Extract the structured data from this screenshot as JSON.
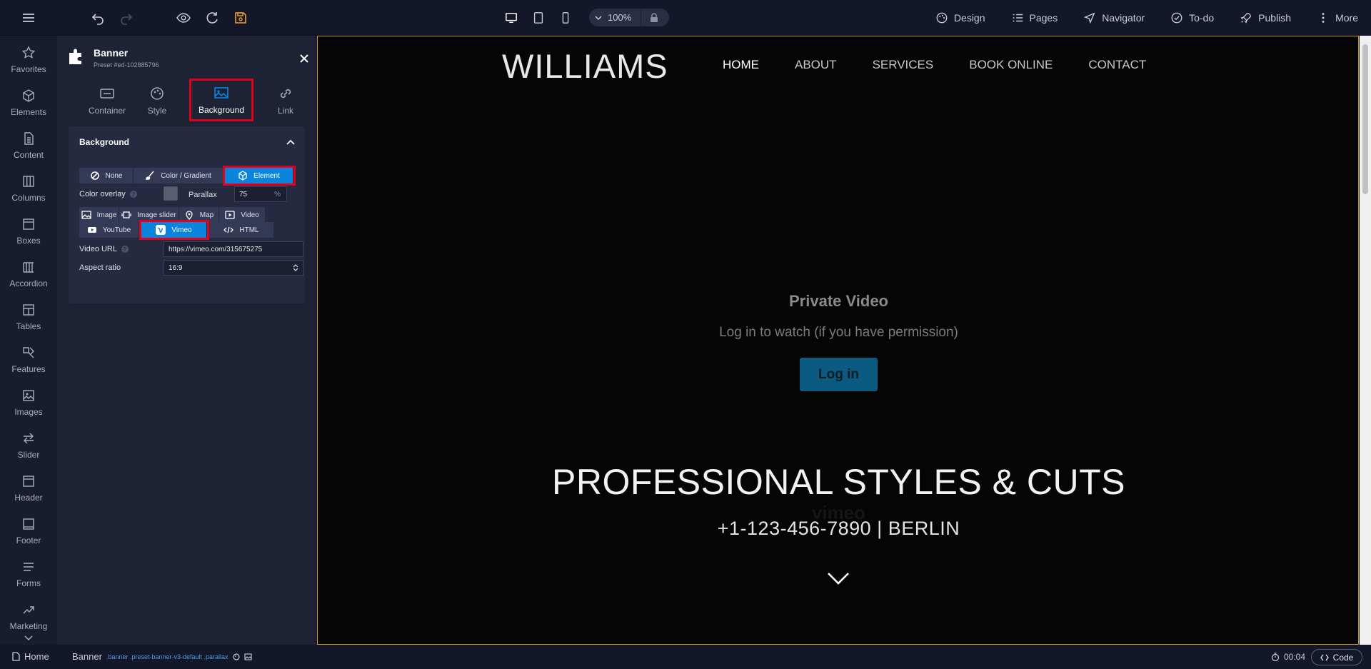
{
  "toolbar": {
    "zoom": "100%",
    "nav": [
      {
        "label": "Design",
        "icon": "palette-icon"
      },
      {
        "label": "Pages",
        "icon": "list-icon"
      },
      {
        "label": "Navigator",
        "icon": "navigation-arrow-icon"
      },
      {
        "label": "To-do",
        "icon": "check-circle-icon"
      },
      {
        "label": "Publish",
        "icon": "rocket-icon"
      },
      {
        "label": "More",
        "icon": "more-vertical-icon"
      }
    ]
  },
  "sidebar": {
    "items": [
      {
        "label": "Favorites",
        "icon": "star-icon"
      },
      {
        "label": "Elements",
        "icon": "cube-icon"
      },
      {
        "label": "Content",
        "icon": "document-icon"
      },
      {
        "label": "Columns",
        "icon": "columns-icon"
      },
      {
        "label": "Boxes",
        "icon": "box-icon"
      },
      {
        "label": "Accordion",
        "icon": "accordion-icon"
      },
      {
        "label": "Tables",
        "icon": "table-icon"
      },
      {
        "label": "Features",
        "icon": "features-icon"
      },
      {
        "label": "Images",
        "icon": "image-icon"
      },
      {
        "label": "Slider",
        "icon": "slider-arrows-icon"
      },
      {
        "label": "Header",
        "icon": "header-icon"
      },
      {
        "label": "Footer",
        "icon": "footer-icon"
      },
      {
        "label": "Forms",
        "icon": "form-icon"
      },
      {
        "label": "Marketing",
        "icon": "trend-icon"
      }
    ]
  },
  "panel": {
    "title": "Banner",
    "subtitle": "Preset #ed-102885796",
    "tabs": [
      "Container",
      "Style",
      "Background",
      "Link"
    ],
    "section_title": "Background",
    "bg_types": [
      "None",
      "Color / Gradient",
      "Element"
    ],
    "color_overlay_label": "Color overlay",
    "parallax_label": "Parallax",
    "parallax_value": "75",
    "parallax_unit": "%",
    "element_types_row1": [
      "Image",
      "Image slider",
      "Map",
      "Video"
    ],
    "element_types_row2": [
      "YouTube",
      "Vimeo",
      "HTML"
    ],
    "video_url_label": "Video URL",
    "video_url": "https://vimeo.com/315675275",
    "aspect_label": "Aspect ratio",
    "aspect_value": "16:9"
  },
  "site": {
    "logo": "WILLIAMS",
    "nav": [
      "HOME",
      "ABOUT",
      "SERVICES",
      "BOOK ONLINE",
      "CONTACT"
    ],
    "video_title": "Private Video",
    "video_sub": "Log in to watch (if you have permission)",
    "video_button": "Log in",
    "vimeo_mark": "vimeo",
    "hero_title": "PROFESSIONAL STYLES & CUTS",
    "hero_sub": "+1-123-456-7890 | BERLIN"
  },
  "status": {
    "home": "Home",
    "element": "Banner",
    "classes": ".banner .preset-banner-v3-default .parallax",
    "time": "00:04",
    "code": "Code"
  },
  "colors": {
    "accent": "#0a84dc",
    "highlight": "#e3001b",
    "save_icon": "#f0a023",
    "canvas_border": "#c8962b"
  }
}
